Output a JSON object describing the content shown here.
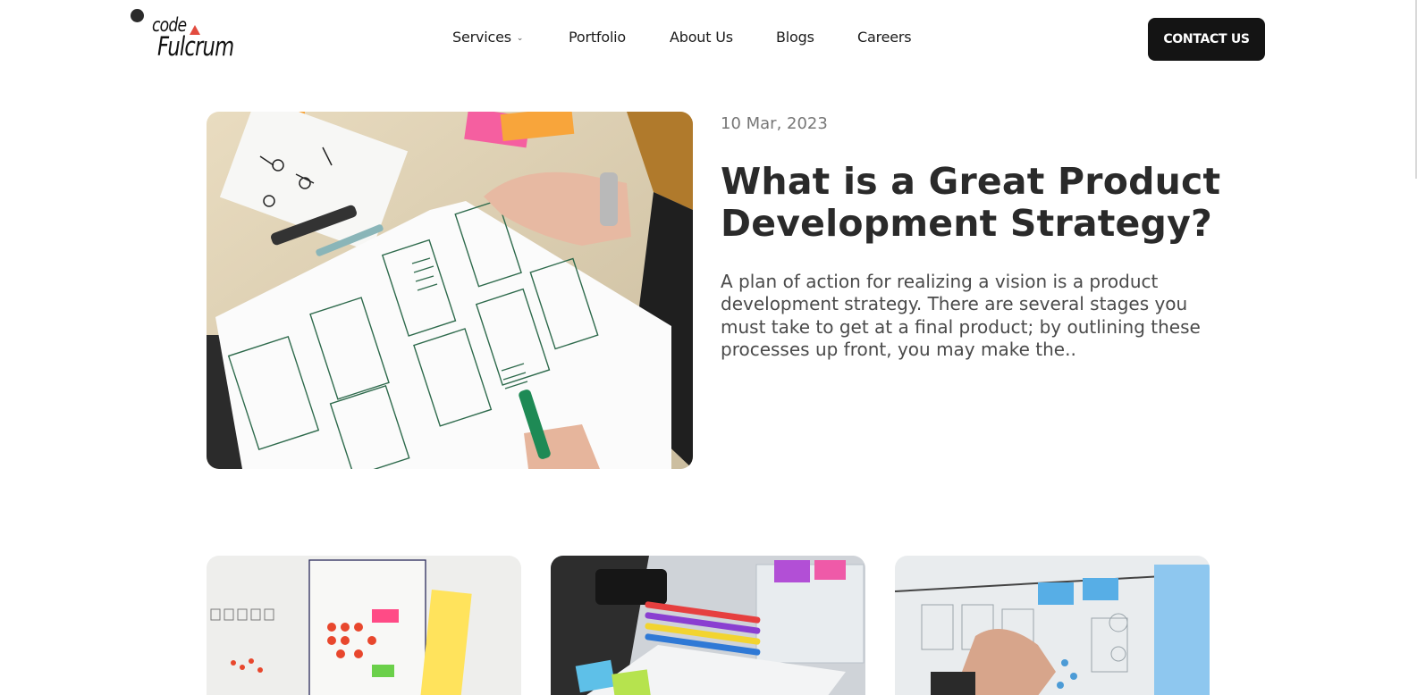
{
  "brand": {
    "logo_line1": "code",
    "logo_line2": "Fulcrum"
  },
  "nav": {
    "items": [
      {
        "label": "Services",
        "has_dropdown": true
      },
      {
        "label": "Portfolio"
      },
      {
        "label": "About Us"
      },
      {
        "label": "Blogs"
      },
      {
        "label": "Careers"
      }
    ],
    "cta_label": "CONTACT US"
  },
  "featured": {
    "date": "10 Mar, 2023",
    "title": "What is a Great Product Development Strategy?",
    "excerpt": "A plan of action for realizing a vision is a product development strategy. There are several stages you must take to get at a final product; by outlining these processes up front, you may make the.."
  },
  "colors": {
    "accent": "#e24b3f",
    "button_bg": "#141414",
    "text_dark": "#2a2a2a",
    "text_muted": "#777777"
  }
}
